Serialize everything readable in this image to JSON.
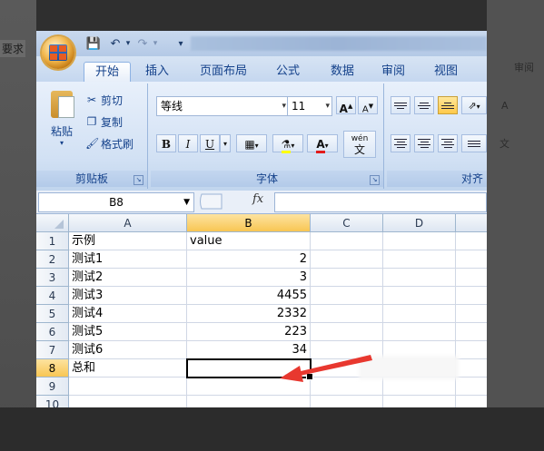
{
  "background": {
    "left_fragment": "要求",
    "right_fragments": [
      "审阅",
      "A",
      "文"
    ]
  },
  "quick_access": {
    "save_icon": "save-icon",
    "undo_icon": "undo-icon",
    "redo_icon": "redo-icon"
  },
  "tabs": [
    "开始",
    "插入",
    "页面布局",
    "公式",
    "数据",
    "审阅",
    "视图"
  ],
  "active_tab": "开始",
  "clipboard": {
    "paste": "粘贴",
    "cut": "剪切",
    "copy": "复制",
    "format_painter": "格式刷",
    "group_label": "剪贴板"
  },
  "font": {
    "name": "等线",
    "size": "11",
    "bold": "B",
    "italic": "I",
    "underline": "U",
    "wen": "wén",
    "wen_char": "文",
    "font_color_letter": "A",
    "increase": "A",
    "decrease": "A",
    "group_label": "字体"
  },
  "alignment": {
    "group_label": "对齐"
  },
  "formula_bar": {
    "name_box": "B8",
    "fx": "fx",
    "content": ""
  },
  "columns": [
    "A",
    "B",
    "C",
    "D"
  ],
  "selected_column": "B",
  "rows": [
    {
      "n": "1",
      "a": "示例",
      "b": "value"
    },
    {
      "n": "2",
      "a": "测试1",
      "b": "2"
    },
    {
      "n": "3",
      "a": "测试2",
      "b": "3"
    },
    {
      "n": "4",
      "a": "测试3",
      "b": "4455"
    },
    {
      "n": "5",
      "a": "测试4",
      "b": "2332"
    },
    {
      "n": "6",
      "a": "测试5",
      "b": "223"
    },
    {
      "n": "7",
      "a": "测试6",
      "b": "34"
    },
    {
      "n": "8",
      "a": "总和",
      "b": ""
    },
    {
      "n": "9",
      "a": "",
      "b": ""
    },
    {
      "n": "10",
      "a": "",
      "b": ""
    }
  ],
  "selected_row": "8",
  "accent_colors": {
    "arrow": "#e8382f",
    "selection_header": "#f8c653"
  }
}
